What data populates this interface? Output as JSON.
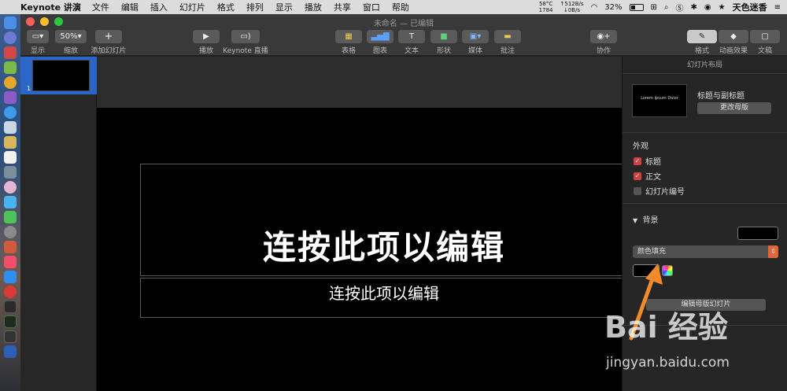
{
  "menubar": {
    "app_name": "Keynote 讲演",
    "items": [
      "文件",
      "编辑",
      "插入",
      "幻灯片",
      "格式",
      "排列",
      "显示",
      "播放",
      "共享",
      "窗口",
      "帮助"
    ],
    "temp": "58°C",
    "temp2": "1784",
    "net_up": "↑512B/s",
    "net_down": "↓0B/s",
    "battery": "32%",
    "user": "天色迷香"
  },
  "window": {
    "title": "未命名 — 已编辑",
    "toolbar": {
      "view": "显示",
      "zoom_value": "50%",
      "zoom": "缩放",
      "add_slide": "添加幻灯片",
      "play": "播放",
      "keynote_live": "Keynote 直播",
      "table": "表格",
      "chart": "图表",
      "text": "文本",
      "shape": "形状",
      "media": "媒体",
      "comment": "批注",
      "collaborate": "协作",
      "format": "格式",
      "animate": "动画效果",
      "document": "文稿"
    }
  },
  "navigator": {
    "slide_number": "1"
  },
  "slide": {
    "title_placeholder": "连按此项以编辑",
    "body_placeholder": "连按此项以编辑"
  },
  "inspector": {
    "header": "幻灯片布局",
    "master_thumb_text": "Lorem Ipsum Dolor",
    "master_name": "标题与副标题",
    "change_master": "更改母版",
    "appearance": "外观",
    "opt_title": "标题",
    "opt_body": "正文",
    "opt_slide_number": "幻灯片编号",
    "background": "背景",
    "fill_type": "颜色填充",
    "edit_master": "编辑母版幻灯片"
  },
  "watermark": {
    "brand": "Bai 经验",
    "url": "jingyan.baidu.com"
  },
  "colors": {
    "accent_arrow": "#f08a2a",
    "checkbox_on": "#d23f3f",
    "selection": "#2b66c8"
  }
}
